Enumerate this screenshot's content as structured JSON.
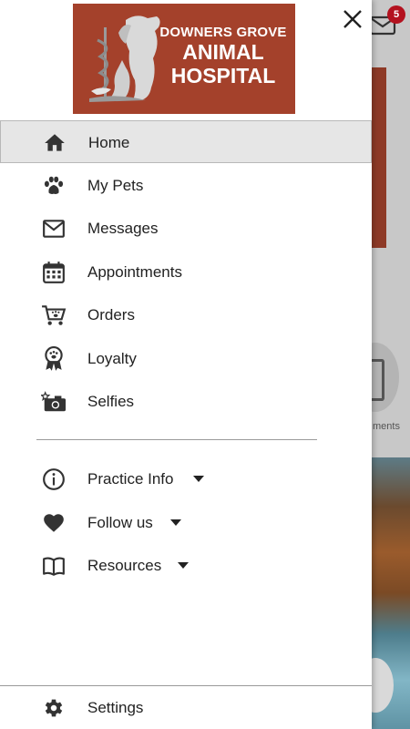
{
  "background": {
    "partial_label": "ments",
    "mail_badge_count": "5"
  },
  "logo": {
    "line1": "DOWNERS GROVE",
    "line2": "ANIMAL",
    "line3": "HOSPITAL"
  },
  "menu": {
    "primary": [
      {
        "label": "Home",
        "icon": "home-icon",
        "active": true
      },
      {
        "label": "My Pets",
        "icon": "paw-icon"
      },
      {
        "label": "Messages",
        "icon": "mail-icon"
      },
      {
        "label": "Appointments",
        "icon": "calendar-icon"
      },
      {
        "label": "Orders",
        "icon": "cart-icon"
      },
      {
        "label": "Loyalty",
        "icon": "award-ribbon-icon"
      },
      {
        "label": "Selfies",
        "icon": "camera-star-icon"
      }
    ],
    "secondary": [
      {
        "label": "Practice Info",
        "icon": "info-icon",
        "expandable": true
      },
      {
        "label": "Follow us",
        "icon": "heart-icon",
        "expandable": true
      },
      {
        "label": "Resources",
        "icon": "book-icon",
        "expandable": true
      }
    ],
    "footer": {
      "label": "Settings",
      "icon": "gear-icon"
    }
  },
  "colors": {
    "logo_bg": "#a4412b",
    "badge": "#b3121f",
    "active_bg": "#e6e6e6"
  }
}
